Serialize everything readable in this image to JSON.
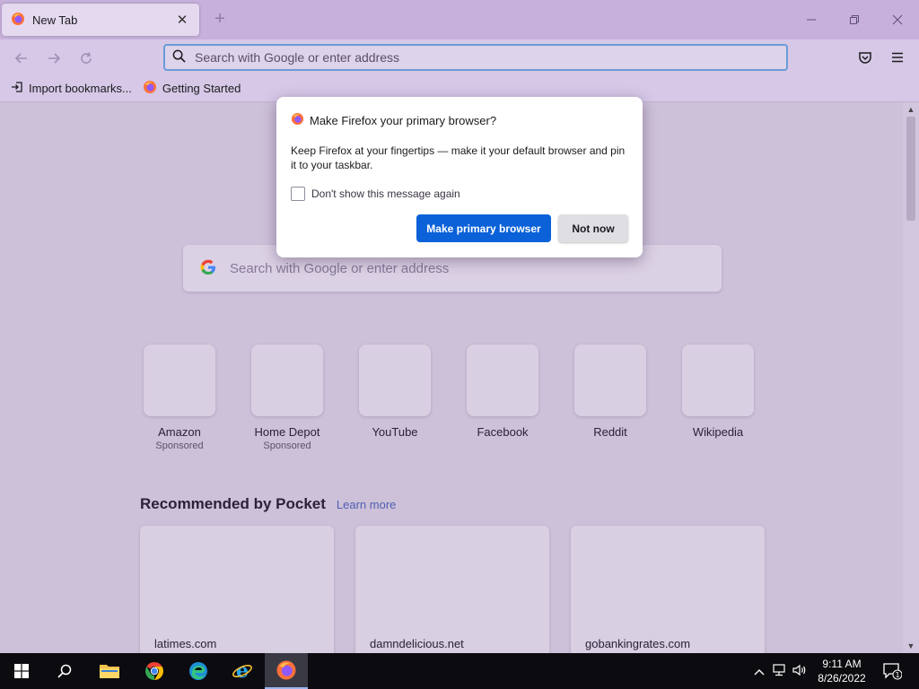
{
  "browser": {
    "tab": {
      "title": "New Tab"
    },
    "urlbar": {
      "placeholder": "Search with Google or enter address"
    },
    "bookmarks": [
      {
        "label": "Import bookmarks..."
      },
      {
        "label": "Getting Started"
      }
    ]
  },
  "newtab": {
    "search": {
      "placeholder": "Search with Google or enter address"
    },
    "top_sites": [
      {
        "label": "Amazon",
        "sub": "Sponsored"
      },
      {
        "label": "Home Depot",
        "sub": "Sponsored"
      },
      {
        "label": "YouTube",
        "sub": ""
      },
      {
        "label": "Facebook",
        "sub": ""
      },
      {
        "label": "Reddit",
        "sub": ""
      },
      {
        "label": "Wikipedia",
        "sub": ""
      }
    ],
    "pocket": {
      "title": "Recommended by Pocket",
      "learn_more": "Learn more",
      "cards": [
        {
          "source": "latimes.com"
        },
        {
          "source": "damndelicious.net"
        },
        {
          "source": "gobankingrates.com"
        }
      ]
    }
  },
  "dialog": {
    "title": "Make Firefox your primary browser?",
    "body": "Keep Firefox at your fingertips — make it your default browser and pin it to your taskbar.",
    "checkbox_label": "Don't show this message again",
    "primary_button": "Make primary browser",
    "secondary_button": "Not now"
  },
  "taskbar": {
    "time": "9:11 AM",
    "date": "8/26/2022",
    "notification_count": "1"
  },
  "colors": {
    "primary_button": "#0a61d8",
    "tab_strip": "#c7b1dc",
    "taskbar": "#0b0b10"
  }
}
